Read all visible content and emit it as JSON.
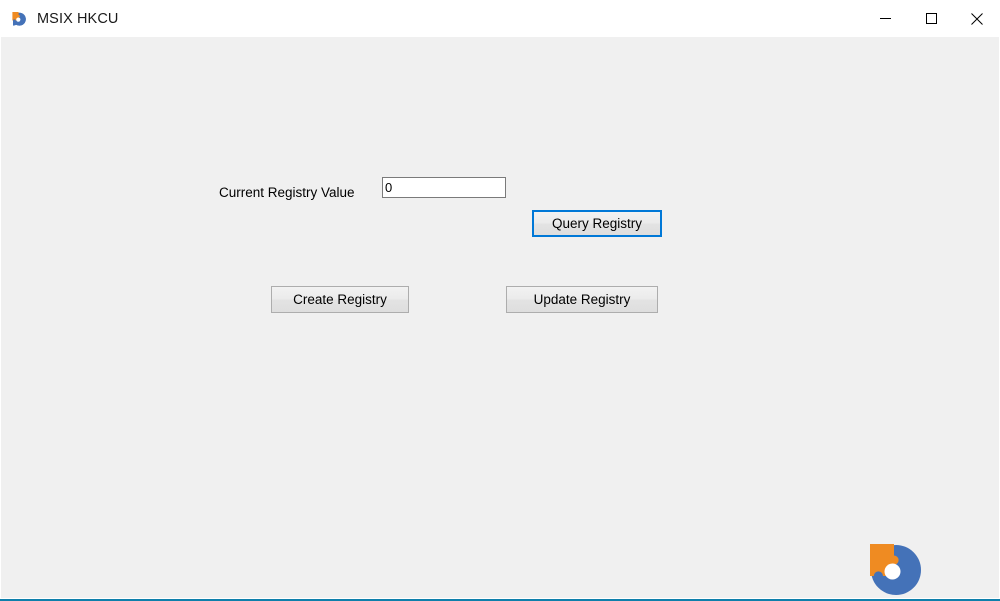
{
  "window": {
    "title": "MSIX HKCU",
    "icon": "msix-app-icon",
    "controls": {
      "minimize": "minimize-icon",
      "maximize": "maximize-icon",
      "close": "close-icon"
    }
  },
  "form": {
    "registry_value_label": "Current Registry Value",
    "registry_value": "0",
    "registry_value_placeholder": ""
  },
  "buttons": {
    "query": "Query Registry",
    "create": "Create Registry",
    "update": "Update Registry"
  },
  "branding": {
    "logo_name": "msix-puzzle-logo",
    "orange": "#EF8B22",
    "blue": "#4472B8"
  },
  "colors": {
    "titlebar_background": "#FFFFFF",
    "client_background": "#F0F0F0",
    "accent_focus_border": "#0078D7",
    "bottom_border": "#0E7FAB",
    "text": "#000000"
  }
}
